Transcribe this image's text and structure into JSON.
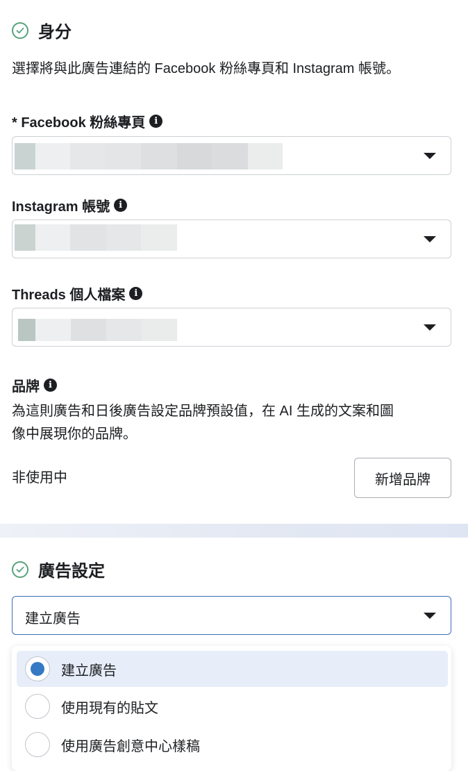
{
  "identity": {
    "title": "身分",
    "description": "選擇將與此廣告連結的 Facebook 粉絲專頁和 Instagram 帳號。",
    "facebook_page": {
      "label": "* Facebook 粉絲專頁"
    },
    "instagram_account": {
      "label": "Instagram 帳號"
    },
    "threads_profile": {
      "label": "Threads 個人檔案"
    },
    "brand": {
      "label": "品牌",
      "description_line1": "為這則廣告和日後廣告設定品牌預設值，在 AI 生成的文案和圖",
      "description_line2": "像中展現你的品牌。",
      "status": "非使用中",
      "add_button": "新增品牌"
    }
  },
  "ad_setup": {
    "title": "廣告設定",
    "selected_value": "建立廣告",
    "options": [
      {
        "label": "建立廣告",
        "selected": true
      },
      {
        "label": "使用現有的貼文",
        "selected": false
      },
      {
        "label": "使用廣告創意中心樣稿",
        "selected": false
      }
    ]
  },
  "icons": {
    "section_check": "check-circle-icon",
    "info": "info-icon",
    "dropdown": "caret-down-icon"
  },
  "colors": {
    "check": "#55a27a",
    "selected_radio": "#3578c4",
    "selected_option_bg": "#e7eef9",
    "focus_border": "#3b6fb6"
  }
}
